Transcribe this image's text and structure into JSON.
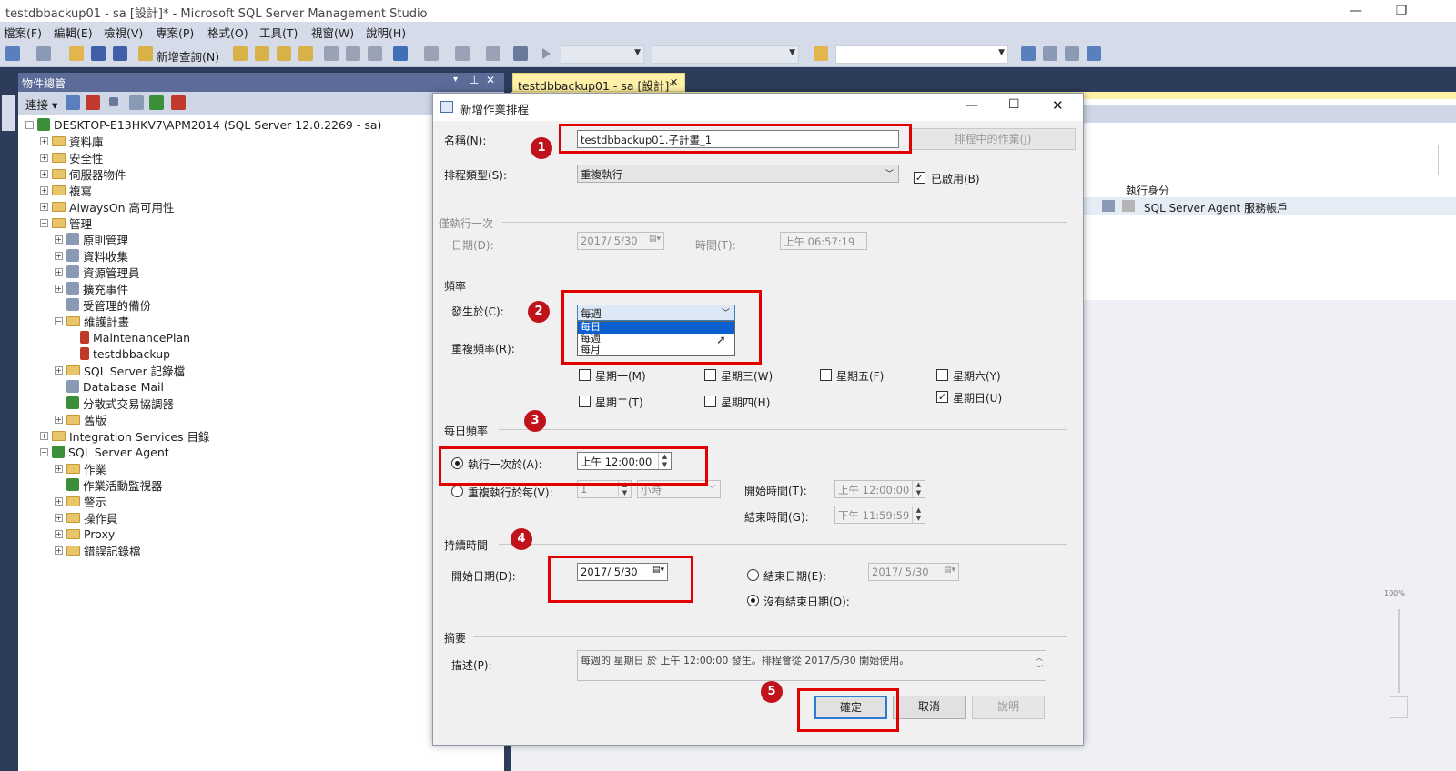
{
  "window": {
    "title": "testdbbackup01 - sa [設計]* - Microsoft SQL Server Management Studio"
  },
  "menu": [
    "檔案(F)",
    "編輯(E)",
    "檢視(V)",
    "專案(P)",
    "格式(O)",
    "工具(T)",
    "視窗(W)",
    "說明(H)"
  ],
  "toolbar": {
    "new_query": "新增查詢(N)"
  },
  "object_explorer": {
    "title": "物件總管",
    "connect": "連接",
    "server": "DESKTOP-E13HKV7\\APM2014 (SQL Server 12.0.2269 - sa)",
    "nodes": [
      "資料庫",
      "安全性",
      "伺服器物件",
      "複寫",
      "AlwaysOn 高可用性",
      "管理",
      "原則管理",
      "資料收集",
      "資源管理員",
      "擴充事件",
      "受管理的備份",
      "維護計畫",
      "MaintenancePlan",
      "testdbbackup",
      "SQL Server 記錄檔",
      "Database Mail",
      "分散式交易協調器",
      "舊版",
      "Integration Services 目錄",
      "SQL Server Agent",
      "作業",
      "作業活動監視器",
      "警示",
      "操作員",
      "Proxy",
      "錯誤記錄檔"
    ]
  },
  "doc_tab": {
    "label": "testdbbackup01 - sa [設計]*"
  },
  "doc_grid": {
    "col_header": "執行身分",
    "cell": "SQL Server Agent 服務帳戶"
  },
  "zoom": {
    "label": "100%"
  },
  "dialog": {
    "title": "新增作業排程",
    "name_label": "名稱(N):",
    "name_value": "testdbbackup01.子計畫_1",
    "jobs_button": "排程中的作業(J)",
    "type_label": "排程類型(S):",
    "type_value": "重複執行",
    "enabled_label": "已啟用(B)",
    "once_section": "僅執行一次",
    "once_date_label": "日期(D):",
    "once_date": "2017/ 5/30",
    "once_time_label": "時間(T):",
    "once_time": "上午 06:57:19",
    "freq_section": "頻率",
    "occurs_label": "發生於(C):",
    "occurs_value": "每週",
    "occurs_options": [
      "每日",
      "每週",
      "每月"
    ],
    "recur_label": "重複頻率(R):",
    "days": [
      "星期一(M)",
      "星期三(W)",
      "星期五(F)",
      "星期六(Y)",
      "星期二(T)",
      "星期四(H)",
      "星期日(U)"
    ],
    "daily_section": "每日頻率",
    "once_at_label": "執行一次於(A):",
    "once_at_value": "上午 12:00:00",
    "every_label": "重複執行於每(V):",
    "every_value": "1",
    "every_unit": "小時",
    "start_time_label": "開始時間(T):",
    "start_time": "上午 12:00:00",
    "end_time_label": "結束時間(G):",
    "end_time": "下午 11:59:59",
    "duration_section": "持續時間",
    "start_date_label": "開始日期(D):",
    "start_date": "2017/ 5/30",
    "end_date_label": "結束日期(E):",
    "end_date": "2017/ 5/30",
    "no_end_label": "沒有結束日期(O):",
    "summary_section": "摘要",
    "desc_label": "描述(P):",
    "desc_value": "每週的 星期日 於 上午 12:00:00 發生。排程會從 2017/5/30 開始使用。",
    "ok": "確定",
    "cancel": "取消",
    "help": "說明"
  },
  "badges": [
    "1",
    "2",
    "3",
    "4",
    "5"
  ]
}
